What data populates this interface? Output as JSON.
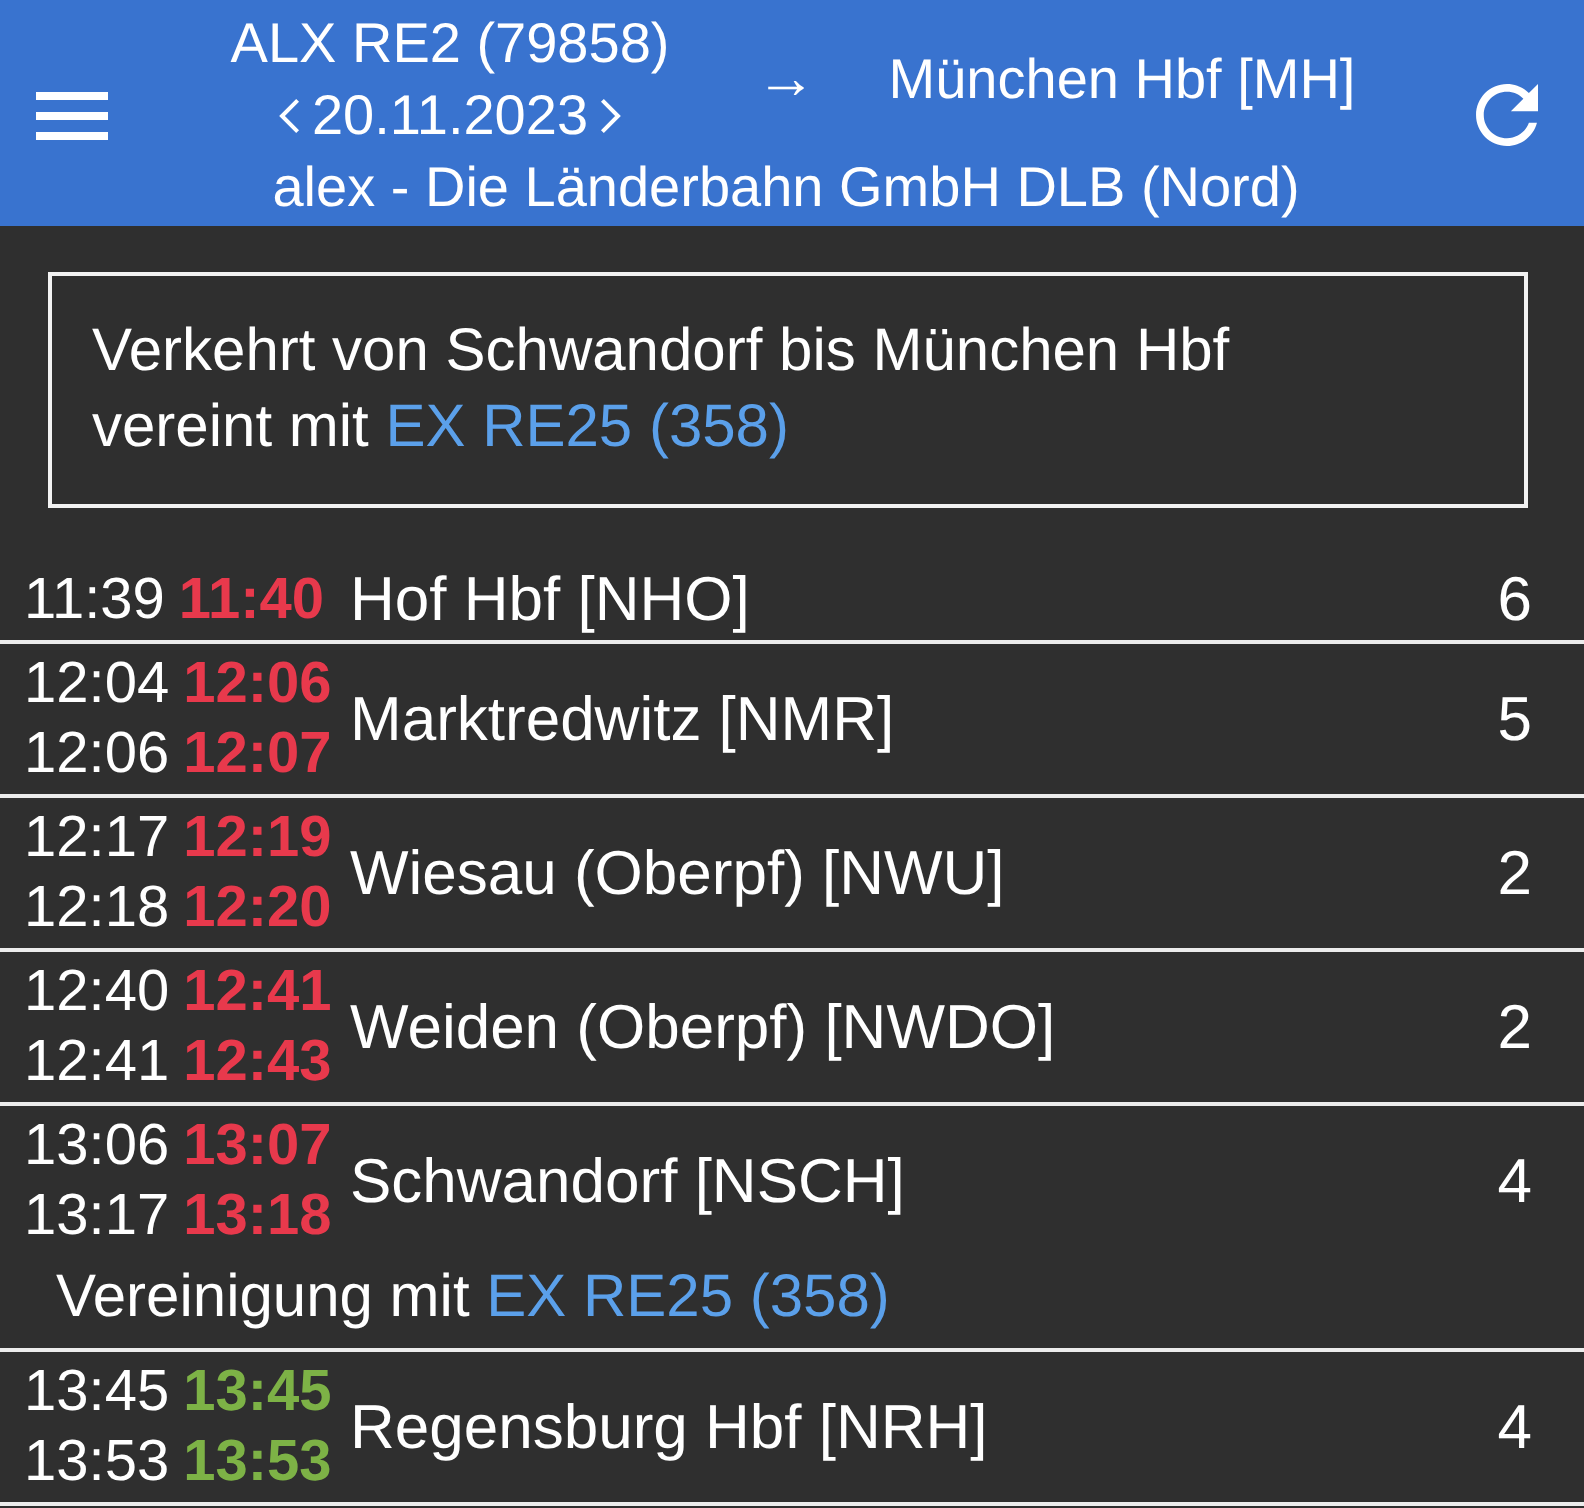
{
  "header": {
    "train": "ALX RE2 (79858)",
    "date": "20.11.2023",
    "arrow": "→",
    "destination": "München Hbf [MH]",
    "operator": "alex - Die Länderbahn GmbH DLB (Nord)"
  },
  "notice": {
    "text": "Verkehrt von Schwandorf bis München Hbf vereint mit",
    "link": "EX RE25 (358)"
  },
  "stops": [
    {
      "times": [
        {
          "scheduled": "11:39",
          "actual": "11:40",
          "delayed": true
        }
      ],
      "station": "Hof Hbf [NHO]",
      "platform": "6"
    },
    {
      "times": [
        {
          "scheduled": "12:04",
          "actual": "12:06",
          "delayed": true
        },
        {
          "scheduled": "12:06",
          "actual": "12:07",
          "delayed": true
        }
      ],
      "station": "Marktredwitz [NMR]",
      "platform": "5"
    },
    {
      "times": [
        {
          "scheduled": "12:17",
          "actual": "12:19",
          "delayed": true
        },
        {
          "scheduled": "12:18",
          "actual": "12:20",
          "delayed": true
        }
      ],
      "station": "Wiesau (Oberpf) [NWU]",
      "platform": "2"
    },
    {
      "times": [
        {
          "scheduled": "12:40",
          "actual": "12:41",
          "delayed": true
        },
        {
          "scheduled": "12:41",
          "actual": "12:43",
          "delayed": true
        }
      ],
      "station": "Weiden (Oberpf) [NWDO]",
      "platform": "2"
    },
    {
      "times": [
        {
          "scheduled": "13:06",
          "actual": "13:07",
          "delayed": true
        },
        {
          "scheduled": "13:17",
          "actual": "13:18",
          "delayed": true
        }
      ],
      "station": "Schwandorf [NSCH]",
      "platform": "4",
      "note": {
        "text": "Vereinigung mit",
        "link": "EX RE25 (358)"
      }
    },
    {
      "times": [
        {
          "scheduled": "13:45",
          "actual": "13:45",
          "delayed": false
        },
        {
          "scheduled": "13:53",
          "actual": "13:53",
          "delayed": false
        }
      ],
      "station": "Regensburg Hbf [NRH]",
      "platform": "4"
    }
  ]
}
